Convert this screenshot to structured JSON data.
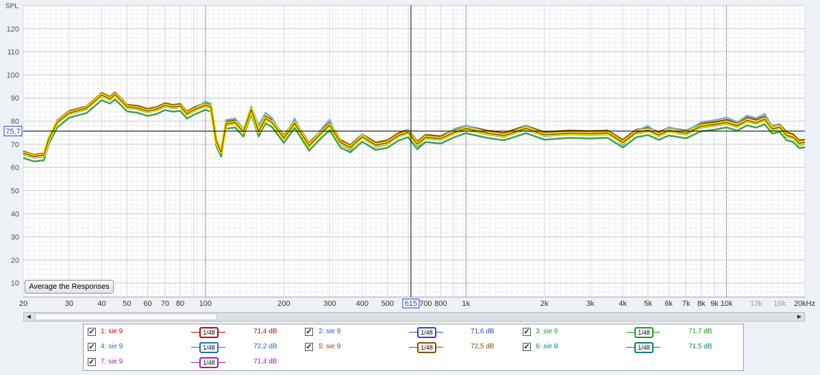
{
  "chart_data": {
    "type": "line",
    "ylabel": "SPL",
    "xunit": "Hz",
    "ylim": [
      4,
      130
    ],
    "xlim": [
      20,
      20000
    ],
    "x_scale": "log",
    "y_ticks": [
      "120",
      "110",
      "100",
      "90",
      "80",
      "70",
      "60",
      "50",
      "40",
      "30",
      "20",
      "10"
    ],
    "x_ticks": [
      {
        "v": 20,
        "l": "20"
      },
      {
        "v": 30,
        "l": "30"
      },
      {
        "v": 40,
        "l": "40"
      },
      {
        "v": 50,
        "l": "50"
      },
      {
        "v": 60,
        "l": "60"
      },
      {
        "v": 70,
        "l": "70"
      },
      {
        "v": 80,
        "l": "80"
      },
      {
        "v": 100,
        "l": "100"
      },
      {
        "v": 200,
        "l": "200"
      },
      {
        "v": 300,
        "l": "300"
      },
      {
        "v": 400,
        "l": "400"
      },
      {
        "v": 500,
        "l": "500"
      },
      {
        "v": 700,
        "l": "700"
      },
      {
        "v": 800,
        "l": "800"
      },
      {
        "v": 1000,
        "l": "1k"
      },
      {
        "v": 2000,
        "l": "2k"
      },
      {
        "v": 3000,
        "l": "3k"
      },
      {
        "v": 4000,
        "l": "4k"
      },
      {
        "v": 5000,
        "l": "5k"
      },
      {
        "v": 6000,
        "l": "6k"
      },
      {
        "v": 7000,
        "l": "7k"
      },
      {
        "v": 8000,
        "l": "8k"
      },
      {
        "v": 9000,
        "l": "9k"
      },
      {
        "v": 10000,
        "l": "10k"
      },
      {
        "v": 13000,
        "l": "13k"
      },
      {
        "v": 16000,
        "l": "16k"
      },
      {
        "v": 20000,
        "l": "20kHz"
      }
    ],
    "hline": {
      "value": 75.7,
      "label": "75,7"
    },
    "cursor": {
      "value": 615,
      "label": "615"
    },
    "grid": true,
    "x": [
      20,
      22,
      24,
      25,
      27,
      30,
      35,
      40,
      43,
      45,
      48,
      50,
      55,
      60,
      65,
      70,
      75,
      80,
      85,
      90,
      100,
      105,
      110,
      115,
      120,
      130,
      140,
      150,
      160,
      170,
      180,
      200,
      220,
      250,
      280,
      300,
      330,
      360,
      400,
      450,
      500,
      550,
      600,
      650,
      700,
      800,
      900,
      1000,
      1200,
      1400,
      1700,
      2000,
      2500,
      3000,
      3500,
      4000,
      4500,
      5000,
      5500,
      6000,
      7000,
      8000,
      9000,
      10000,
      11000,
      12000,
      13000,
      14000,
      15000,
      16000,
      17000,
      18000,
      19000,
      20000
    ],
    "series": [
      {
        "name": "sie 9",
        "color": "#c24444",
        "values": [
          66.0,
          64.4,
          64.9,
          71.8,
          79.1,
          83.3,
          85.3,
          90.9,
          89.3,
          91.2,
          88.0,
          85.8,
          85.3,
          84.1,
          84.8,
          86.5,
          85.7,
          86.1,
          82.7,
          84.4,
          86.7,
          85.8,
          70.9,
          66.2,
          78.6,
          79.0,
          75.0,
          84.8,
          75.0,
          80.8,
          79.2,
          72.4,
          78.8,
          69.1,
          74.8,
          77.9,
          70.4,
          68.2,
          72.8,
          69.3,
          70.2,
          73.3,
          74.9,
          69.7,
          72.6,
          72.0,
          74.7,
          76.5,
          74.5,
          73.4,
          76.5,
          73.7,
          74.4,
          74.2,
          74.5,
          70.4,
          74.7,
          75.7,
          73.6,
          75.6,
          74.3,
          77.4,
          78.1,
          79.0,
          77.6,
          79.9,
          78.9,
          80.4,
          76.3,
          77.1,
          73.5,
          72.7,
          70.1,
          70.5
        ]
      },
      {
        "name": "sie 9",
        "color": "#4a4ac8",
        "values": [
          65.8,
          64.3,
          65.0,
          71.8,
          79.2,
          83.2,
          85.2,
          90.9,
          89.3,
          91.1,
          88.0,
          85.9,
          85.3,
          83.9,
          84.9,
          86.5,
          85.8,
          86.1,
          82.8,
          84.5,
          86.5,
          85.9,
          71.0,
          66.2,
          78.4,
          79.0,
          75.0,
          84.8,
          75.1,
          80.8,
          79.2,
          72.4,
          78.8,
          69.1,
          74.8,
          77.9,
          70.4,
          68.2,
          72.9,
          69.3,
          70.2,
          73.3,
          74.8,
          69.8,
          72.7,
          72.0,
          74.7,
          76.4,
          74.5,
          73.4,
          76.5,
          73.7,
          74.4,
          74.3,
          74.5,
          70.4,
          74.7,
          75.7,
          73.6,
          75.6,
          74.3,
          77.4,
          78.1,
          79.0,
          77.7,
          79.9,
          78.9,
          80.4,
          76.3,
          77.0,
          73.4,
          72.7,
          70.0,
          70.5
        ]
      },
      {
        "name": "sie 9",
        "color": "#3fa33f",
        "values": [
          64.1,
          62.6,
          63.1,
          70.0,
          77.3,
          81.5,
          83.5,
          89.1,
          87.6,
          89.4,
          86.3,
          84.2,
          83.6,
          82.3,
          83.1,
          84.8,
          84.1,
          84.4,
          81.1,
          82.7,
          84.9,
          84.1,
          69.3,
          64.6,
          76.7,
          77.3,
          73.3,
          83.1,
          73.4,
          79.1,
          77.5,
          70.6,
          77.1,
          67.3,
          73.0,
          76.1,
          68.6,
          66.5,
          71.1,
          67.6,
          68.5,
          71.6,
          73.1,
          67.9,
          71.0,
          70.3,
          73.0,
          74.8,
          72.8,
          71.7,
          74.8,
          72.0,
          72.8,
          72.5,
          72.8,
          68.6,
          73.0,
          74.0,
          71.9,
          73.8,
          72.6,
          75.7,
          76.3,
          77.3,
          75.9,
          78.2,
          77.2,
          78.7,
          74.6,
          75.4,
          71.8,
          71.0,
          68.4,
          68.7
        ]
      },
      {
        "name": "sie 9",
        "color": "#1f6fbf",
        "values": [
          65.7,
          64.2,
          64.8,
          71.6,
          79.0,
          83.0,
          85.1,
          90.8,
          89.1,
          91.0,
          87.9,
          85.7,
          85.1,
          83.8,
          84.7,
          86.3,
          85.6,
          86.0,
          82.6,
          84.3,
          86.4,
          85.7,
          70.8,
          66.0,
          78.3,
          78.9,
          74.9,
          84.6,
          74.9,
          80.7,
          79.0,
          72.2,
          78.6,
          68.9,
          74.6,
          77.8,
          70.3,
          68.1,
          72.7,
          69.2,
          70.1,
          73.2,
          74.7,
          69.6,
          72.5,
          71.9,
          74.6,
          76.3,
          74.4,
          73.2,
          76.4,
          73.6,
          74.3,
          74.1,
          74.4,
          70.3,
          74.6,
          75.6,
          73.5,
          75.5,
          74.2,
          77.3,
          78.0,
          78.9,
          77.5,
          79.8,
          78.8,
          80.3,
          76.1,
          76.9,
          73.3,
          72.6,
          69.9,
          70.4
        ]
      },
      {
        "name": "sie 9",
        "color": "#8c5a14",
        "values": [
          67.0,
          65.4,
          66.1,
          72.9,
          80.3,
          84.4,
          86.4,
          92.2,
          90.5,
          92.4,
          89.3,
          87.1,
          86.6,
          85.3,
          86.1,
          87.8,
          87.0,
          87.5,
          84.1,
          85.8,
          88.0,
          87.2,
          72.3,
          67.6,
          79.8,
          80.5,
          76.4,
          86.2,
          76.5,
          82.2,
          80.6,
          73.8,
          80.2,
          70.5,
          76.2,
          79.4,
          71.9,
          69.6,
          74.3,
          70.8,
          71.7,
          74.8,
          76.3,
          71.2,
          74.1,
          73.5,
          76.2,
          78.0,
          76.0,
          74.9,
          78.0,
          75.2,
          76.0,
          75.7,
          76.0,
          71.9,
          76.3,
          77.3,
          75.2,
          77.2,
          75.9,
          79.0,
          79.6,
          80.6,
          79.3,
          81.6,
          80.6,
          82.1,
          77.9,
          78.7,
          75.2,
          74.4,
          71.7,
          72.1
        ]
      },
      {
        "name": "sie 9",
        "color": "#7fb0c8",
        "values": [
          66.2,
          64.6,
          65.2,
          72.0,
          79.4,
          83.6,
          85.6,
          91.3,
          89.6,
          91.6,
          88.4,
          86.2,
          85.8,
          84.5,
          85.3,
          86.9,
          86.1,
          86.6,
          83.2,
          84.9,
          88.5,
          87.6,
          72.0,
          66.5,
          80.5,
          81.2,
          76.6,
          86.4,
          78.1,
          83.6,
          81.5,
          72.7,
          81.2,
          68.8,
          76.9,
          80.6,
          70.1,
          67.4,
          74.4,
          68.8,
          69.9,
          73.8,
          76.2,
          68.5,
          72.8,
          72.3,
          76.6,
          78.1,
          75.2,
          73.6,
          77.8,
          74.3,
          75.3,
          75.1,
          75.5,
          69.6,
          75.8,
          78.0,
          74.2,
          77.4,
          75.5,
          79.6,
          80.4,
          81.6,
          79.6,
          82.4,
          81.3,
          83.2,
          77.6,
          78.5,
          73.8,
          72.8,
          69.6,
          70.1
        ]
      },
      {
        "name": "sie 9",
        "color": "#a32da3",
        "values": [
          65.9,
          64.3,
          64.9,
          71.7,
          79.1,
          83.1,
          85.2,
          90.9,
          89.2,
          91.1,
          88.0,
          85.8,
          85.2,
          83.9,
          84.8,
          86.4,
          85.7,
          86.1,
          82.7,
          84.4,
          86.5,
          85.8,
          70.9,
          66.1,
          78.4,
          79.0,
          75.0,
          84.7,
          75.0,
          80.8,
          79.1,
          72.3,
          78.7,
          69.0,
          74.7,
          77.9,
          70.4,
          68.2,
          72.8,
          69.3,
          70.2,
          73.3,
          74.8,
          69.7,
          72.6,
          72.0,
          74.7,
          76.4,
          74.5,
          73.3,
          76.5,
          73.7,
          74.4,
          74.2,
          74.5,
          70.4,
          74.7,
          75.7,
          73.6,
          75.6,
          74.3,
          77.4,
          78.1,
          79.0,
          77.6,
          79.9,
          78.9,
          80.4,
          76.2,
          77.0,
          73.4,
          72.7,
          70.0,
          70.5
        ]
      }
    ],
    "average_series": {
      "color": "#f2e600",
      "outline_color": "#8a5a00",
      "values": [
        66.2,
        64.7,
        65.3,
        72.1,
        79.5,
        83.5,
        85.6,
        91.3,
        89.6,
        91.5,
        88.4,
        86.2,
        85.6,
        84.3,
        85.2,
        86.8,
        86.1,
        86.5,
        83.1,
        84.8,
        86.9,
        86.2,
        71.3,
        66.5,
        78.8,
        79.4,
        75.4,
        85.1,
        75.4,
        81.2,
        79.5,
        72.7,
        79.1,
        69.4,
        75.1,
        78.3,
        70.8,
        68.6,
        73.2,
        69.7,
        70.6,
        73.7,
        75.2,
        70.1,
        73.0,
        72.4,
        75.1,
        76.8,
        74.9,
        73.7,
        76.9,
        74.1,
        74.8,
        74.6,
        74.9,
        70.8,
        75.1,
        76.1,
        74.0,
        76.0,
        74.7,
        77.8,
        78.5,
        79.4,
        78.0,
        80.3,
        79.3,
        80.8,
        76.6,
        77.4,
        73.8,
        73.1,
        70.4,
        70.9
      ]
    }
  },
  "controls": {
    "average_button": "Average the Responses",
    "scroll_left_icon": "◀",
    "scroll_right_icon": "▶",
    "checkbox_mark": "✓",
    "scroll_thumb_fraction": [
      0.0,
      0.24
    ]
  },
  "legend": [
    {
      "label": "1: sie 9",
      "smoothing": "1/48",
      "value": "71,4 dB",
      "color": "#c00000",
      "checked": true
    },
    {
      "label": "2: sie 9",
      "smoothing": "1/48",
      "value": "71,6 dB",
      "color": "#3a3ad0",
      "checked": true
    },
    {
      "label": "3: sie 9",
      "smoothing": "1/48",
      "value": "71,7 dB",
      "color": "#1a9a1a",
      "checked": true
    },
    {
      "label": "4: sie 9",
      "smoothing": "1/48",
      "value": "72,2 dB",
      "color": "#1a6fc0",
      "checked": true
    },
    {
      "label": "5: sie 9",
      "smoothing": "1/48",
      "value": "72,5 dB",
      "color": "#8a4a00",
      "checked": true
    },
    {
      "label": "6: sie 9",
      "smoothing": "1/48",
      "value": "71,5 dB",
      "color": "#008080",
      "checked": true
    },
    {
      "label": "7: sie 9",
      "smoothing": "1/48",
      "value": "71,4 dB",
      "color": "#9b20b0",
      "checked": true
    }
  ]
}
